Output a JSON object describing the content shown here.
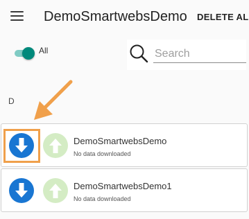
{
  "app": {
    "title": "DemoSmartwebsDemo",
    "delete_all_label": "DELETE ALL",
    "menu_icon": "hamburger-menu-icon"
  },
  "filter": {
    "toggle_on": true,
    "toggle_label": "All",
    "search_placeholder": "Search",
    "search_value": ""
  },
  "section_header": "D",
  "items": [
    {
      "title": "DemoSmartwebsDemo",
      "subtitle": "No data downloaded",
      "download_icon": "download-icon",
      "upload_icon": "upload-icon"
    },
    {
      "title": "DemoSmartwebsDemo1",
      "subtitle": "No data downloaded",
      "download_icon": "download-icon",
      "upload_icon": "upload-icon"
    }
  ],
  "annotation": {
    "arrow_icon": "pointer-arrow-icon",
    "target_item": 0
  },
  "colors": {
    "accent": "#00897b",
    "download": "#1976d2",
    "upload_disabled": "#d4ecc4",
    "annotation": "#f0a04b"
  }
}
